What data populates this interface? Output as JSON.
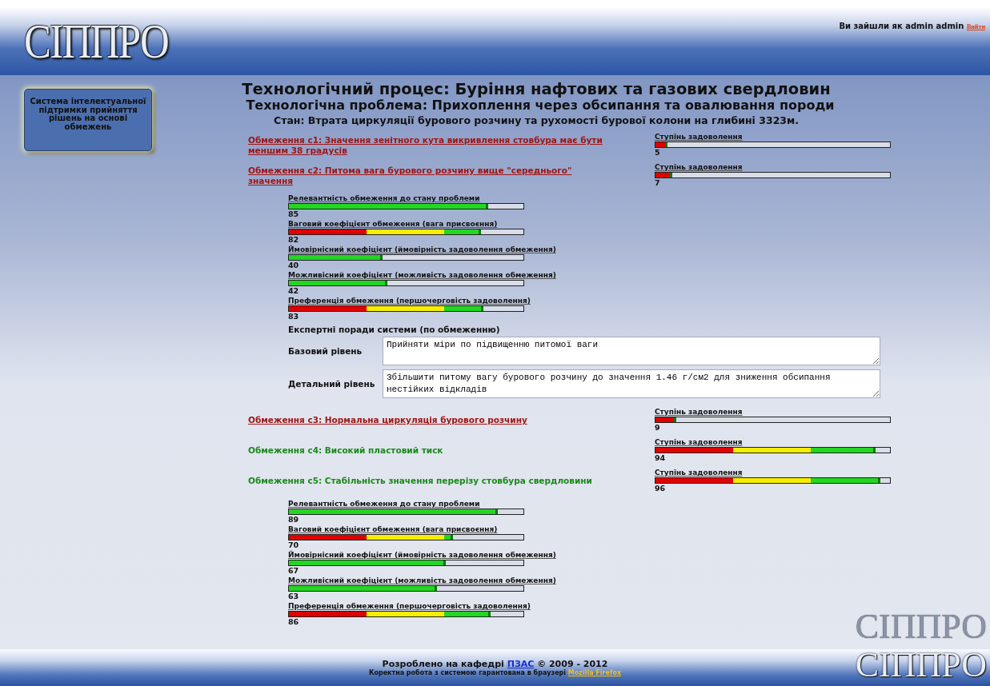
{
  "header": {
    "logo": "СІППРО",
    "login_text": "Ви зайшли як admin admin",
    "logout_link": "Вийти"
  },
  "sidebar": {
    "caption": "Система інтелектуальної підтримки прийняття рішень на основі обмежень"
  },
  "titles": {
    "process": "Технологічний процес: Буріння нафтових та газових свердловин",
    "problem": "Технологічна проблема: Прихоплення через обсипання та овалювання породи",
    "state": "Стан: Втрата циркуляції бурового розчину та рухомості бурової колони на глибині 3323м."
  },
  "constraints": [
    {
      "title": "Обмеження с1: Значення зенітного кута викривлення стовбура має бути меншим 38 градусів",
      "satisfied": false,
      "satisfaction_label": "Ступінь задоволення",
      "level": 0.05,
      "value": "5"
    },
    {
      "title": "Обмеження с2: Питома вага бурового розчину вище \"середнього\" значення",
      "satisfied": false,
      "satisfaction_label": "Ступінь задоволення",
      "level": 0.07,
      "value": "7",
      "metrics": [
        {
          "label": "Релевантність обмеження до стану проблеми",
          "kind": "plain",
          "level": 0.85,
          "value": "85"
        },
        {
          "label": "Ваговий коефіцієнт обмеження (вага присвоєння)",
          "kind": "graded",
          "level": 0.82,
          "value": "82"
        },
        {
          "label": "Ймовірнісний коефіцієнт (ймовірність задоволення обмеження)",
          "kind": "plain",
          "level": 0.4,
          "value": "40"
        },
        {
          "label": "Можливісний коефіцієнт (можливість задоволення обмеження)",
          "kind": "plain",
          "level": 0.42,
          "value": "42"
        },
        {
          "label": "Преференція обмеження (першочерговість задоволення)",
          "kind": "graded",
          "level": 0.83,
          "value": "83"
        }
      ],
      "advice": {
        "heading": "Експертні поради системи (по обмеженню)",
        "rows": [
          {
            "label": "Базовий рівень",
            "value": "Прийняти міри по підвищенню питомої ваги"
          },
          {
            "label": "Детальний рівень",
            "value": "Збільшити питому вагу бурового розчину до значення 1.46 г/см2 для зниження обсипання нестійких відкладів"
          }
        ]
      }
    },
    {
      "title": "Обмеження с3: Нормальна циркуляція бурового розчину",
      "satisfied": false,
      "satisfaction_label": "Ступінь задоволення",
      "level": 0.09,
      "value": "9"
    },
    {
      "title": "Обмеження с4: Високий пластовий тиск",
      "satisfied": true,
      "satisfaction_label": "Ступінь задоволення",
      "level": 0.94,
      "value": "94"
    },
    {
      "title": "Обмеження с5: Стабільність значення перерізу стовбура свердловини",
      "satisfied": true,
      "satisfaction_label": "Ступінь задоволення",
      "level": 0.96,
      "value": "96",
      "metrics": [
        {
          "label": "Релевантність обмеження до стану проблеми",
          "kind": "plain",
          "level": 0.89,
          "value": "89"
        },
        {
          "label": "Ваговий коефіцієнт обмеження (вага присвоєння)",
          "kind": "graded",
          "level": 0.7,
          "value": "70"
        },
        {
          "label": "Ймовірнісний коефіцієнт (ймовірність задоволення обмеження)",
          "kind": "plain",
          "level": 0.67,
          "value": "67"
        },
        {
          "label": "Можливісний коефіцієнт (можливість задоволення обмеження)",
          "kind": "plain",
          "level": 0.63,
          "value": "63"
        },
        {
          "label": "Преференція обмеження (першочерговість задоволення)",
          "kind": "graded",
          "level": 0.86,
          "value": "86"
        }
      ]
    }
  ],
  "footer": {
    "credit_before": "Розроблено на кафедрі ",
    "credit_link": "ПЗАС",
    "credit_after": " © 2009 - 2012",
    "browser_note": "Коректна робота з системою гарантована в браузері ",
    "browser_link": "Mozilla Firefox",
    "corner_logo": "СІППРО",
    "corner_logo_reflection": "СІППРО"
  }
}
